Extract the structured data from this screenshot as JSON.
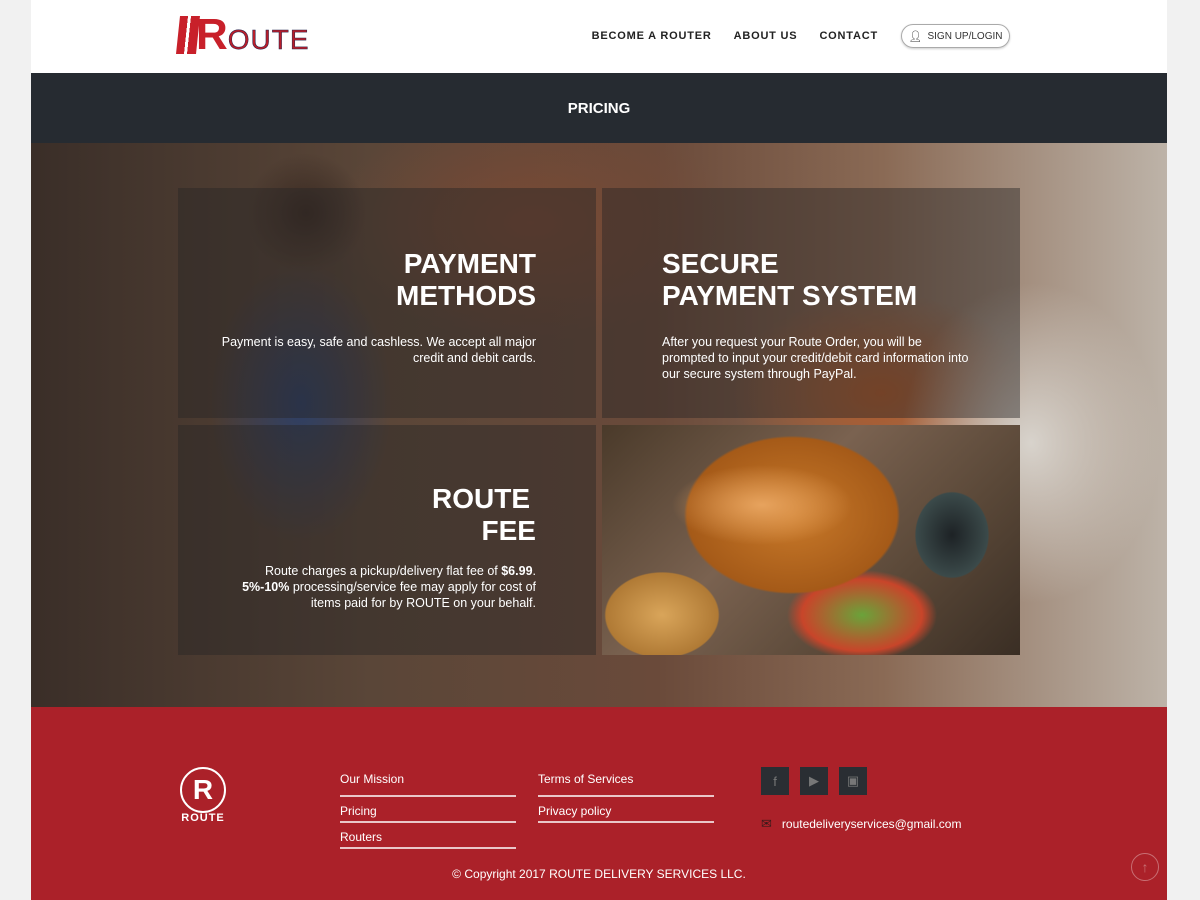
{
  "header": {
    "logo_initial": "R",
    "logo_rest": "OUTE",
    "nav": [
      "BECOME A ROUTER",
      "ABOUT US",
      "CONTACT"
    ],
    "signin": "SIGN UP/LOGIN",
    "signin_icon": "user-icon"
  },
  "band": {
    "title": "PRICING"
  },
  "cards": {
    "payment": {
      "title1": "PAYMENT",
      "title2": "METHODS",
      "text": "Payment is easy, safe and cashless. We accept all major credit and debit cards."
    },
    "secure": {
      "title1": "SECURE",
      "title2": "PAYMENT SYSTEM",
      "text": "After you request your Route Order, you will be prompted to input your credit/debit card information into our secure system through PayPal."
    },
    "fee": {
      "title1": "ROUTE",
      "title2": "FEE",
      "text_a": "Route charges a pickup/delivery flat fee of ",
      "price": "$6.99",
      "text_b": ". ",
      "range": "5%-10%",
      "text_c": " processing/service fee may apply for cost of items paid for by ROUTE on your behalf."
    }
  },
  "footer": {
    "logo_letter": "R",
    "logo_name": "ROUTE",
    "col1": [
      "Our Mission",
      "Pricing",
      "Routers"
    ],
    "col2": [
      "Terms of Services",
      "Privacy policy"
    ],
    "social": [
      "facebook-icon",
      "youtube-icon",
      "instagram-icon"
    ],
    "email": "routedeliveryservices@gmail.com",
    "copyright": "© Copyright 2017 ROUTE DELIVERY SERVICES LLC."
  },
  "colors": {
    "brand_red": "#ab2129",
    "dark_band": "#262b31"
  }
}
